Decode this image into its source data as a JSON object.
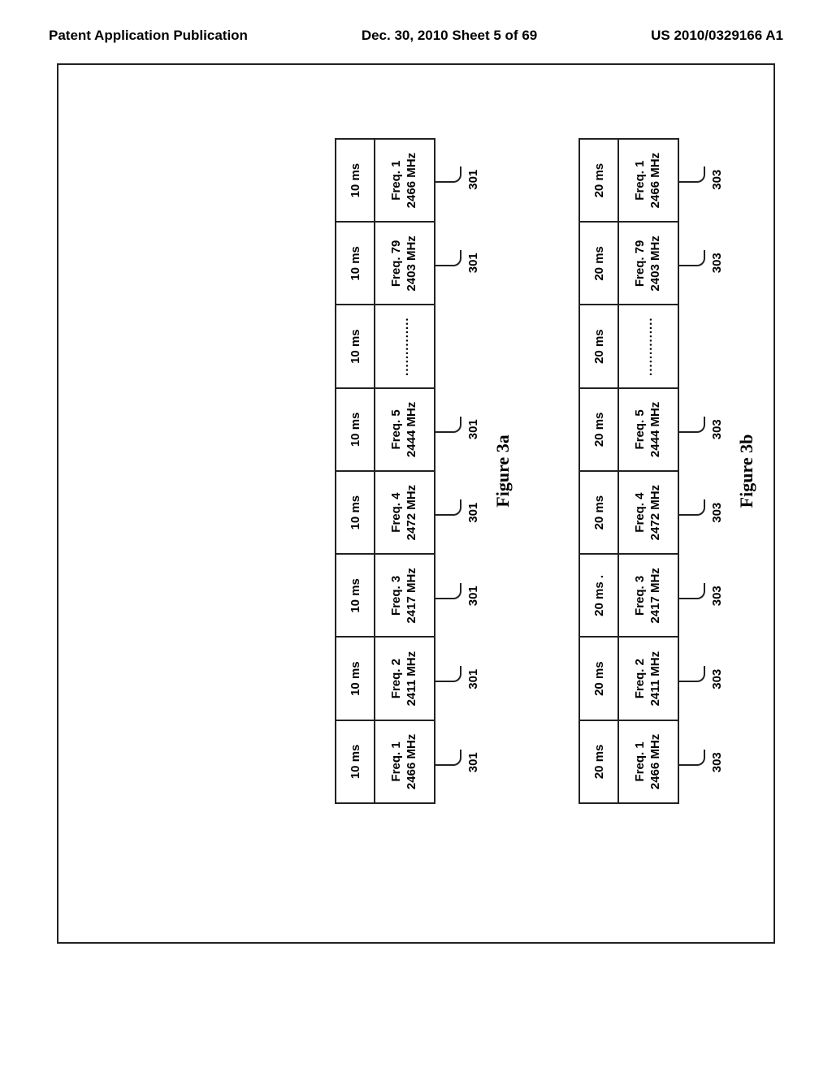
{
  "header": {
    "left": "Patent Application Publication",
    "center": "Dec. 30, 2010  Sheet 5 of 69",
    "right": "US 2010/0329166 A1"
  },
  "figA": {
    "caption": "Figure 3a",
    "ref": "301",
    "timeHeader": [
      "10 ms",
      "10 ms",
      "10 ms",
      "10 ms",
      "10 ms",
      "10 ms",
      "10 ms",
      "10 ms"
    ],
    "freqTop": [
      "Freq. 1",
      "Freq. 2",
      "Freq. 3",
      "Freq. 4",
      "Freq. 5",
      "",
      "Freq. 79",
      "Freq. 1"
    ],
    "freqBot": [
      "2466 MHz",
      "2411 MHz",
      "2417 MHz",
      "2472 MHz",
      "2444 MHz",
      "..............",
      "2403 MHz",
      "2466 MHz"
    ],
    "showRef": [
      true,
      true,
      true,
      true,
      true,
      false,
      true,
      true
    ]
  },
  "figB": {
    "caption": "Figure 3b",
    "ref": "303",
    "timeHeader": [
      "20 ms",
      "20 ms",
      "20 ms .",
      "20 ms",
      "20 ms",
      "20 ms",
      "20 ms",
      "20 ms"
    ],
    "freqTop": [
      "Freq. 1",
      "Freq. 2",
      "Freq. 3",
      "Freq. 4",
      "Freq. 5",
      "",
      "Freq. 79",
      "Freq. 1"
    ],
    "freqBot": [
      "2466 MHz",
      "2411 MHz",
      "2417 MHz",
      "2472 MHz",
      "2444 MHz",
      "..............",
      "2403 MHz",
      "2466 MHz"
    ],
    "showRef": [
      true,
      true,
      true,
      true,
      true,
      false,
      true,
      true
    ]
  }
}
